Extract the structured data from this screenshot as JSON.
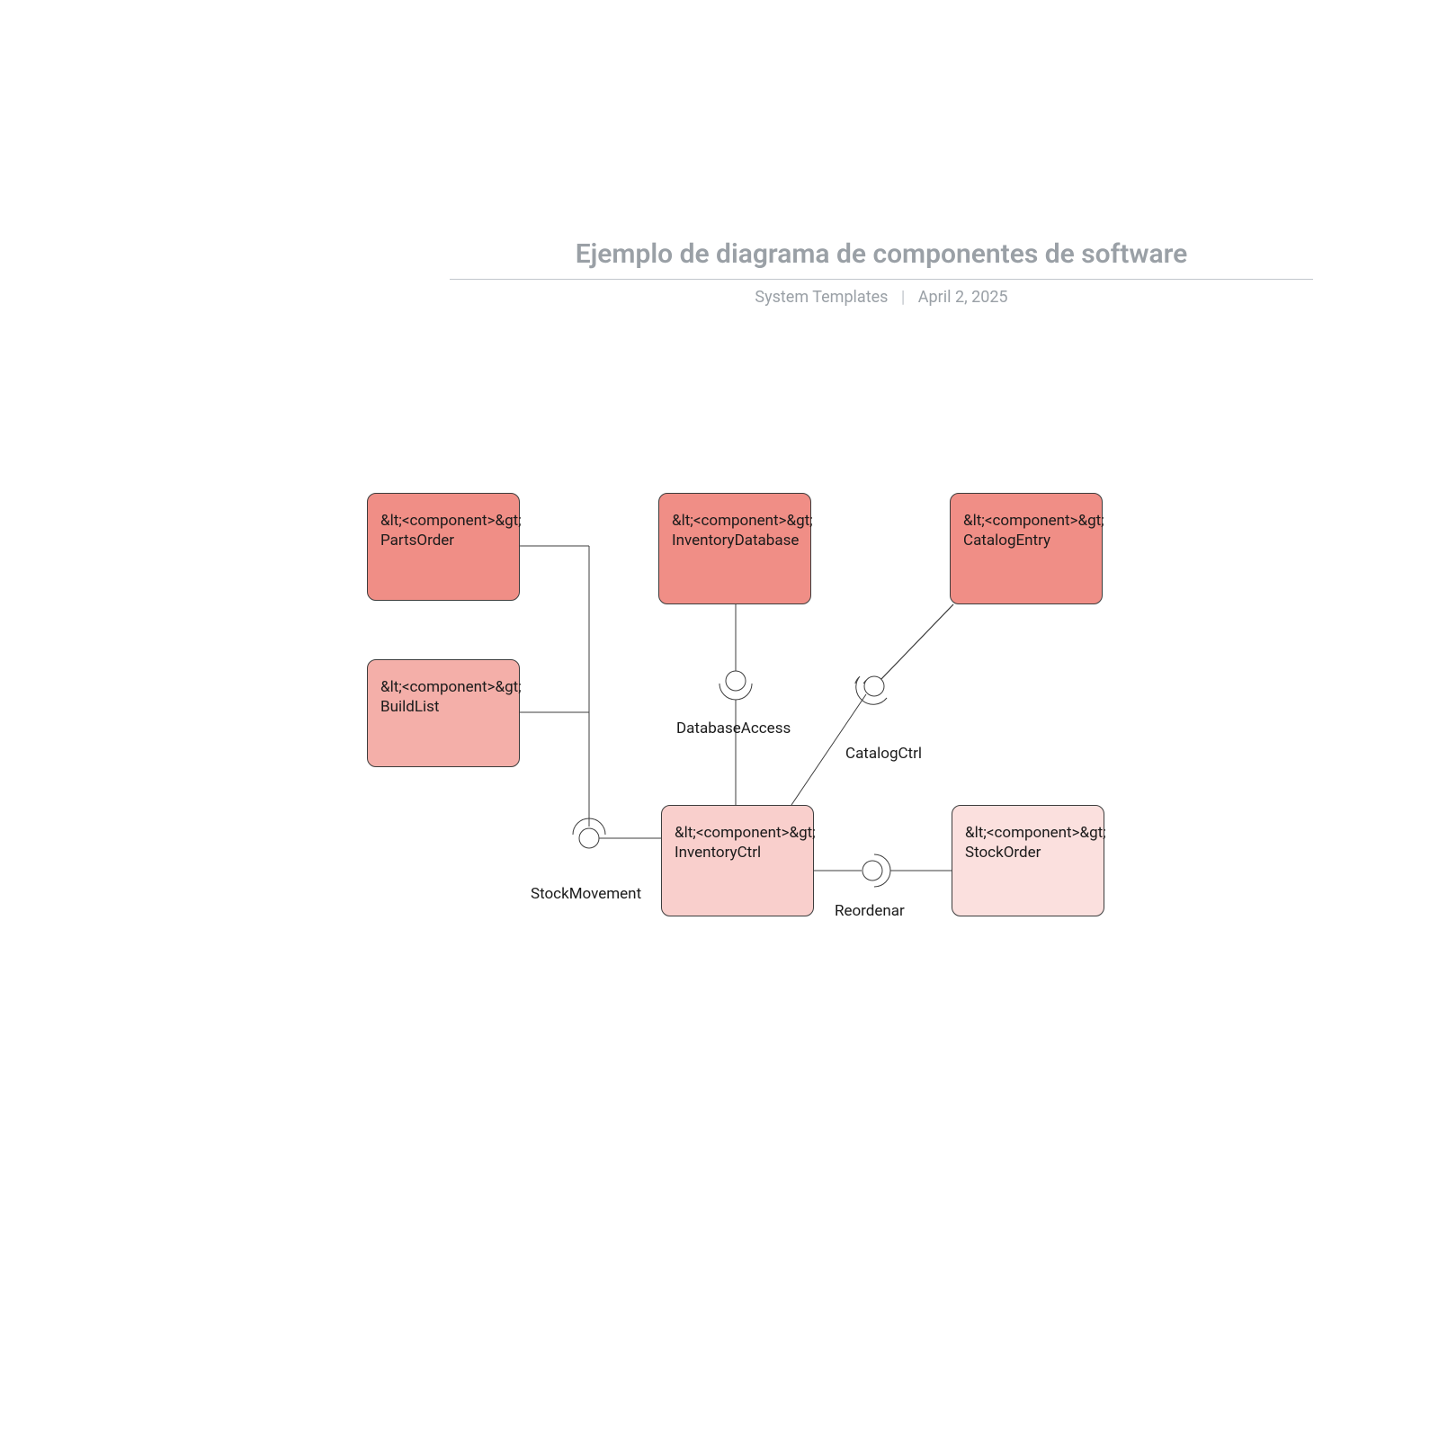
{
  "header": {
    "title": "Ejemplo de diagrama de componentes de software",
    "author": "System Templates",
    "date": "April 2, 2025"
  },
  "stereotype": "&lt;<component>&gt;",
  "components": {
    "partsOrder": {
      "name": "PartsOrder"
    },
    "buildList": {
      "name": "BuildList"
    },
    "inventoryDatabase": {
      "name": "InventoryDatabase"
    },
    "catalogEntry": {
      "name": "CatalogEntry"
    },
    "inventoryCtrl": {
      "name": "InventoryCtrl"
    },
    "stockOrder": {
      "name": "StockOrder"
    }
  },
  "interfaces": {
    "stockMovement": "StockMovement",
    "databaseAccess": "DatabaseAccess",
    "catalogCtrl": "CatalogCtrl",
    "reorder": "Reordenar"
  },
  "chart_data": {
    "type": "uml-component-diagram",
    "components": [
      {
        "id": "PartsOrder",
        "shade": 1
      },
      {
        "id": "BuildList",
        "shade": 2
      },
      {
        "id": "InventoryDatabase",
        "shade": 1
      },
      {
        "id": "CatalogEntry",
        "shade": 1
      },
      {
        "id": "InventoryCtrl",
        "shade": 3
      },
      {
        "id": "StockOrder",
        "shade": 4
      }
    ],
    "interfaces": [
      {
        "name": "StockMovement",
        "provided_by": "InventoryCtrl",
        "required_by": [
          "PartsOrder",
          "BuildList"
        ]
      },
      {
        "name": "DatabaseAccess",
        "provided_by": "InventoryDatabase",
        "required_by": [
          "InventoryCtrl"
        ]
      },
      {
        "name": "CatalogCtrl",
        "provided_by": "CatalogEntry",
        "required_by": [
          "InventoryCtrl"
        ]
      },
      {
        "name": "Reordenar",
        "provided_by": "StockOrder",
        "required_by": [
          "InventoryCtrl"
        ]
      }
    ]
  }
}
